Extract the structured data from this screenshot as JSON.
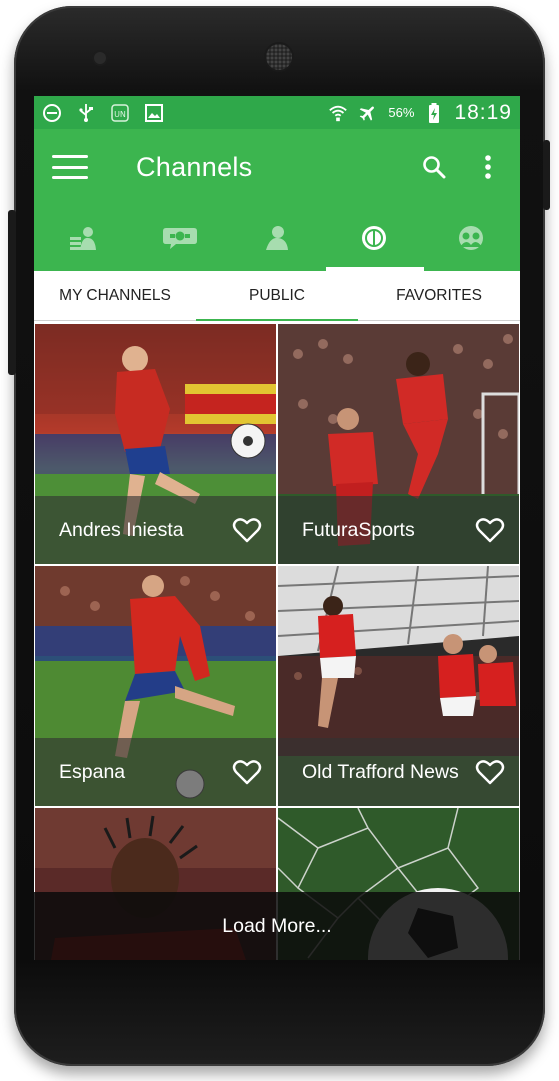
{
  "status_bar": {
    "icons": [
      "do-not-disturb-icon",
      "usb-icon",
      "app-notification-icon",
      "gallery-icon"
    ],
    "battery": "56%",
    "time": "18:19",
    "right_icons": [
      "wifi-icon",
      "airplane-mode-icon",
      "battery-charging-icon"
    ]
  },
  "app_bar": {
    "title": "Channels",
    "menu_icon": "hamburger-menu-icon",
    "actions": [
      "search-icon",
      "more-vert-icon"
    ]
  },
  "icon_tabs": [
    "feed-tab-icon",
    "chat-tab-icon",
    "profile-tab-icon",
    "football-tab-icon",
    "friends-tab-icon"
  ],
  "icon_tab_active": 3,
  "text_tabs": {
    "my_channels": "MY CHANNELS",
    "public": "PUBLIC",
    "favorites": "FAVORITES"
  },
  "channels": [
    {
      "name": "Andres Iniesta"
    },
    {
      "name": "FuturaSports"
    },
    {
      "name": "Espana"
    },
    {
      "name": "Old Trafford News"
    },
    {
      "name": ""
    },
    {
      "name": ""
    }
  ],
  "load_more": "Load More...",
  "colors": {
    "status_bar": "#2fa84a",
    "primary": "#3cb54f",
    "caption_bg": "rgba(50,50,50,0.62)"
  }
}
